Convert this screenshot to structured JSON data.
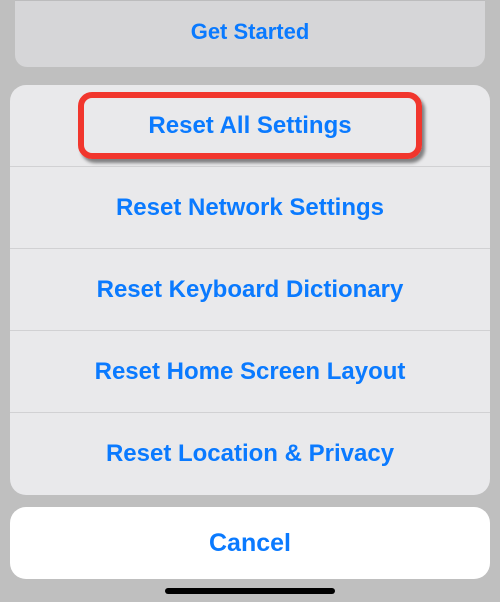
{
  "top_card": {
    "get_started_label": "Get Started"
  },
  "action_sheet": {
    "items": [
      {
        "label": "Reset All Settings",
        "highlighted": true
      },
      {
        "label": "Reset Network Settings"
      },
      {
        "label": "Reset Keyboard Dictionary"
      },
      {
        "label": "Reset Home Screen Layout"
      },
      {
        "label": "Reset Location & Privacy"
      }
    ],
    "cancel_label": "Cancel"
  },
  "colors": {
    "accent": "#0a7aff",
    "highlight_border": "#f1362d"
  }
}
